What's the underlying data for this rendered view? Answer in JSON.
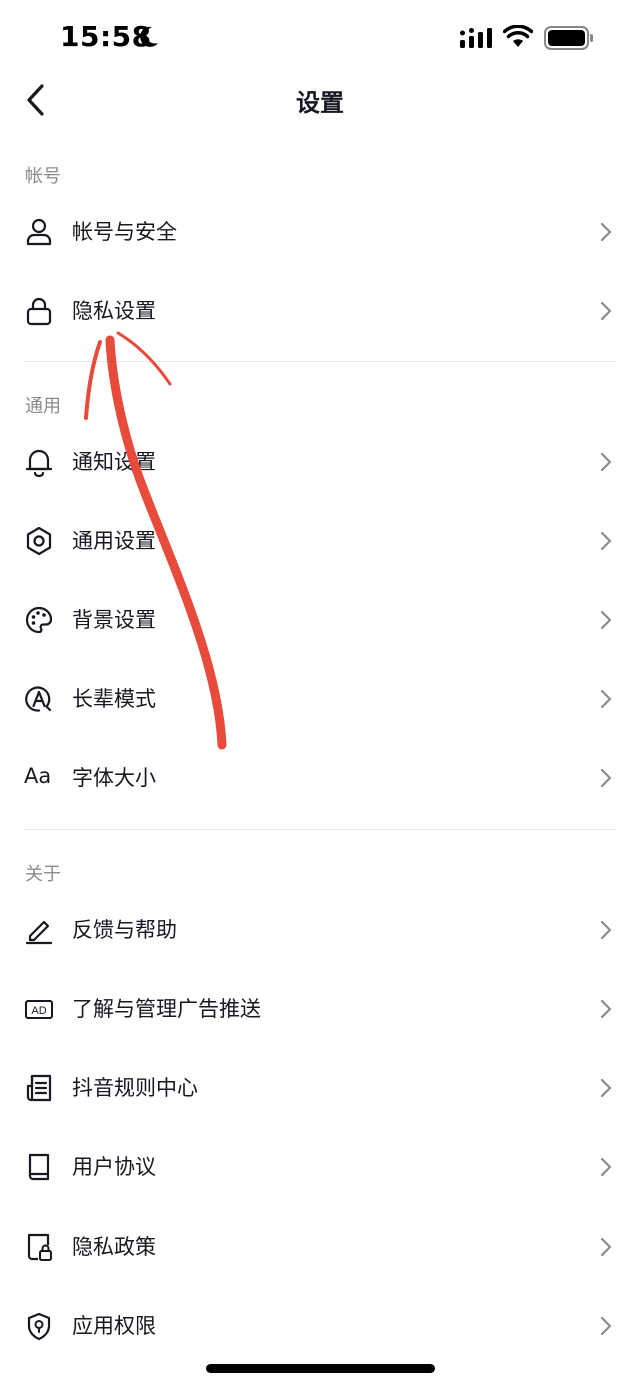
{
  "status_bar": {
    "time": "15:58"
  },
  "nav": {
    "title": "设置"
  },
  "sections": {
    "account": {
      "header": "帐号",
      "items": [
        {
          "label": "帐号与安全",
          "icon": "person-icon"
        },
        {
          "label": "隐私设置",
          "icon": "lock-icon"
        }
      ]
    },
    "general": {
      "header": "通用",
      "items": [
        {
          "label": "通知设置",
          "icon": "bell-icon"
        },
        {
          "label": "通用设置",
          "icon": "gear-icon"
        },
        {
          "label": "背景设置",
          "icon": "palette-icon"
        },
        {
          "label": "长辈模式",
          "icon": "elder-mode-icon"
        },
        {
          "label": "字体大小",
          "icon": "font-size-icon",
          "icon_text": "Aa"
        }
      ]
    },
    "about": {
      "header": "关于",
      "items": [
        {
          "label": "反馈与帮助",
          "icon": "pencil-icon"
        },
        {
          "label": "了解与管理广告推送",
          "icon": "ad-icon",
          "icon_text": "AD"
        },
        {
          "label": "抖音规则中心",
          "icon": "document-icon"
        },
        {
          "label": "用户协议",
          "icon": "book-icon"
        },
        {
          "label": "隐私政策",
          "icon": "privacy-doc-icon"
        },
        {
          "label": "应用权限",
          "icon": "shield-icon"
        }
      ]
    }
  },
  "colors": {
    "text": "#161823",
    "section_header": "#8a8b91",
    "divider": "#e6e6e8",
    "chevron": "#8a8b91",
    "annotation": "#e84b3c"
  }
}
